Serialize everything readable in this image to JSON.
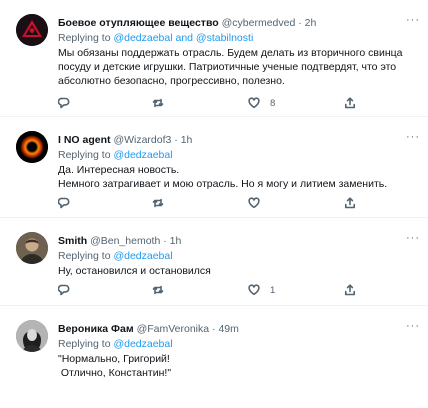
{
  "tweets": [
    {
      "name": "Боевое отупляющее вещество",
      "handle": "@cybermedved",
      "time": "2h",
      "reply_prefix": "Replying to",
      "reply_to": "@dedzaebal and @stabilnosti",
      "lines": [
        "Мы обязаны поддержать отрасль. Будем делать из вторичного свинца",
        "посуду и детские игрушки. Патриотичные ученые подтвердят, что это",
        "абсолютно безопасно, прогрессивно, полезно."
      ],
      "likes": "8",
      "more": "···",
      "avatar_color": "#1a0f14"
    },
    {
      "name": "I NO agent",
      "handle": "@Wizardof3",
      "time": "1h",
      "reply_prefix": "Replying to",
      "reply_to": "@dedzaebal",
      "lines": [
        "Да. Интересная новость.",
        "Немного затрагивает и мою отрасль. Но я могу и литием заменить."
      ],
      "likes": "",
      "more": "···",
      "avatar_color": "#000000"
    },
    {
      "name": "Smith",
      "handle": "@Ben_hemoth",
      "time": "1h",
      "reply_prefix": "Replying to",
      "reply_to": "@dedzaebal",
      "lines": [
        "Ну, остановился и остановился"
      ],
      "likes": "1",
      "more": "···",
      "avatar_color": "#5b5040"
    },
    {
      "name": "Вероника Фам",
      "handle": "@FamVeronika",
      "time": "49m",
      "reply_prefix": "Replying to",
      "reply_to": "@dedzaebal",
      "lines": [
        "\"Нормально, Григорий!",
        " Отлично, Константин!\""
      ],
      "likes": "",
      "more": "···",
      "avatar_color": "#8c8c8c"
    }
  ],
  "separator": "·",
  "colors": {
    "link": "#1d9bf0",
    "secondary": "#536471",
    "text": "#0f1419",
    "divider": "#eff3f4"
  }
}
